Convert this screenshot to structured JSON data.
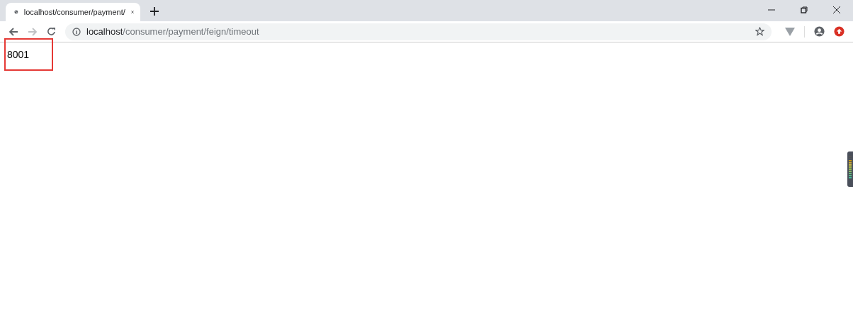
{
  "tabs": [
    {
      "title": "localhost/consumer/payment/",
      "selected": true
    }
  ],
  "address_bar": {
    "host": "localhost",
    "path": "/consumer/payment/feign/timeout",
    "bookmarked": false
  },
  "page": {
    "text": "8001",
    "highlighted": true
  }
}
